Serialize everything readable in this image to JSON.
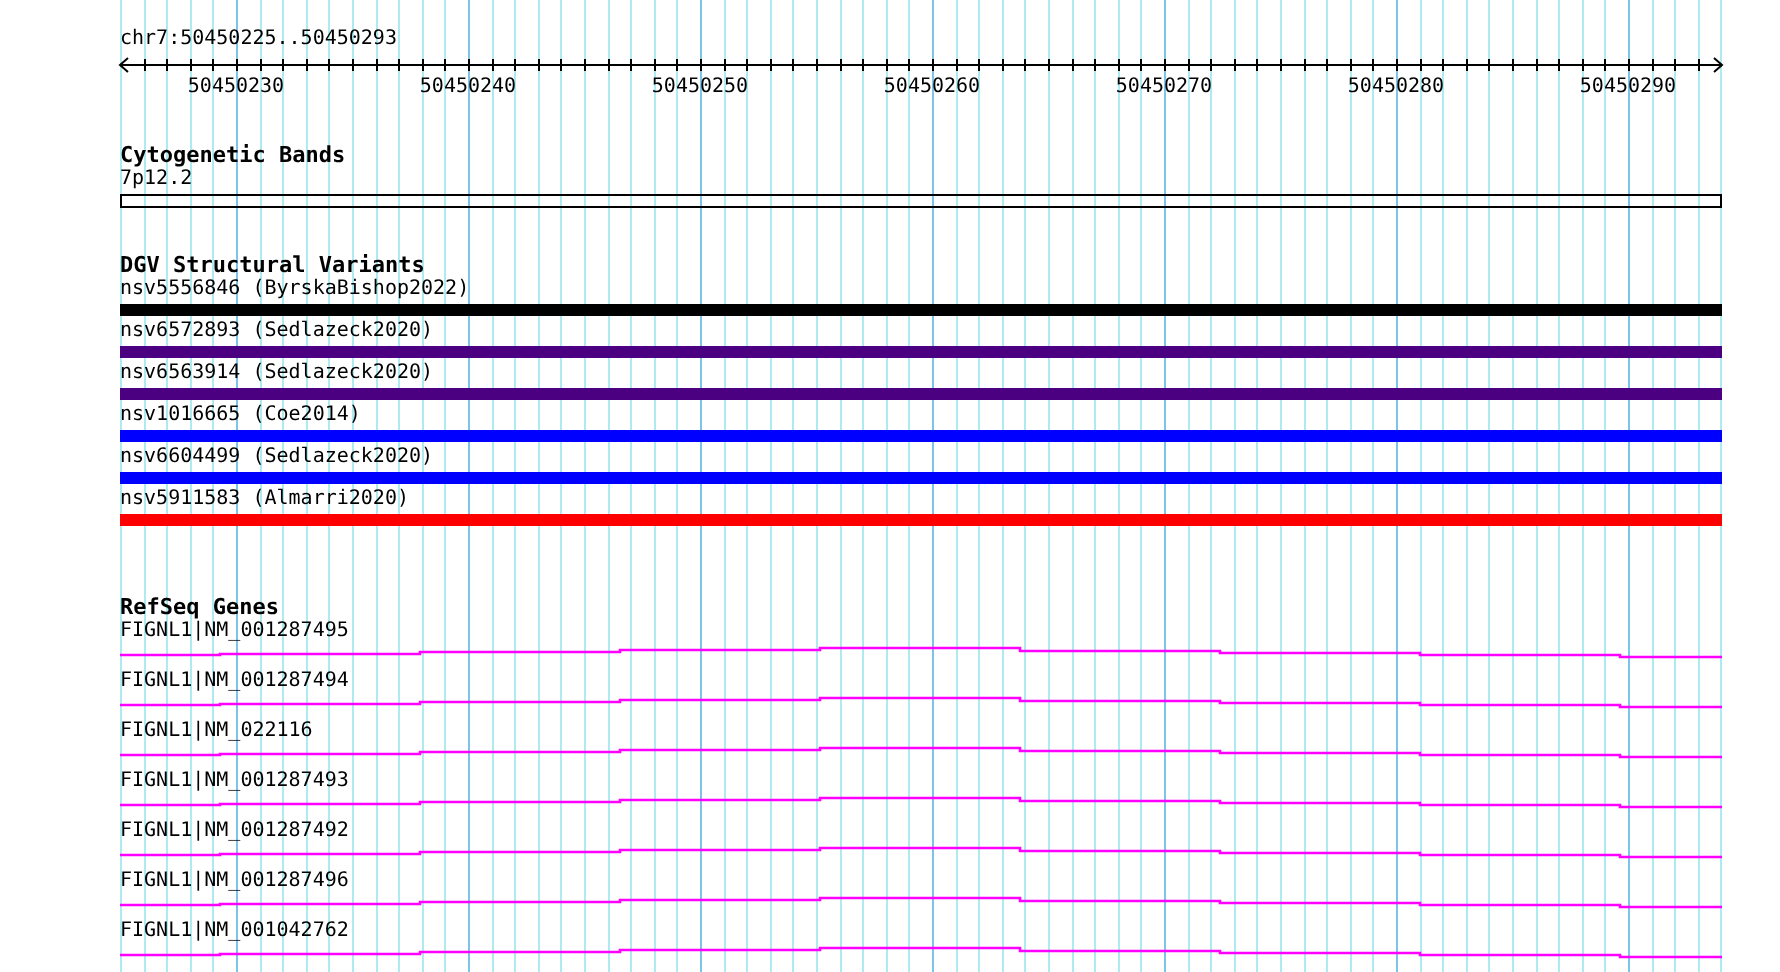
{
  "ruler": {
    "label": "chr7:50450225..50450293",
    "ticks": [
      "50450230",
      "50450240",
      "50450250",
      "50450260",
      "50450270",
      "50450280",
      "50450290"
    ]
  },
  "tracks": [
    {
      "kind": "cytoband",
      "title": "Cytogenetic Bands",
      "items": [
        {
          "label": "7p12.2"
        }
      ]
    },
    {
      "kind": "variants",
      "title": "DGV Structural Variants",
      "items": [
        {
          "label": "nsv5556846 (ByrskaBishop2022)",
          "color": "#000000"
        },
        {
          "label": "nsv6572893 (Sedlazeck2020)",
          "color": "#4b0082"
        },
        {
          "label": "nsv6563914 (Sedlazeck2020)",
          "color": "#4b0082"
        },
        {
          "label": "nsv1016665 (Coe2014)",
          "color": "#0000ff"
        },
        {
          "label": "nsv6604499 (Sedlazeck2020)",
          "color": "#0000ff"
        },
        {
          "label": "nsv5911583 (Almarri2020)",
          "color": "#ff0000"
        }
      ]
    },
    {
      "kind": "genes",
      "title": "RefSeq Genes",
      "items": [
        {
          "label": "FIGNL1|NM_001287495"
        },
        {
          "label": "FIGNL1|NM_001287494"
        },
        {
          "label": "FIGNL1|NM_022116"
        },
        {
          "label": "FIGNL1|NM_001287493"
        },
        {
          "label": "FIGNL1|NM_001287492"
        },
        {
          "label": "FIGNL1|NM_001287496"
        },
        {
          "label": "FIGNL1|NM_001042762"
        }
      ]
    }
  ]
}
